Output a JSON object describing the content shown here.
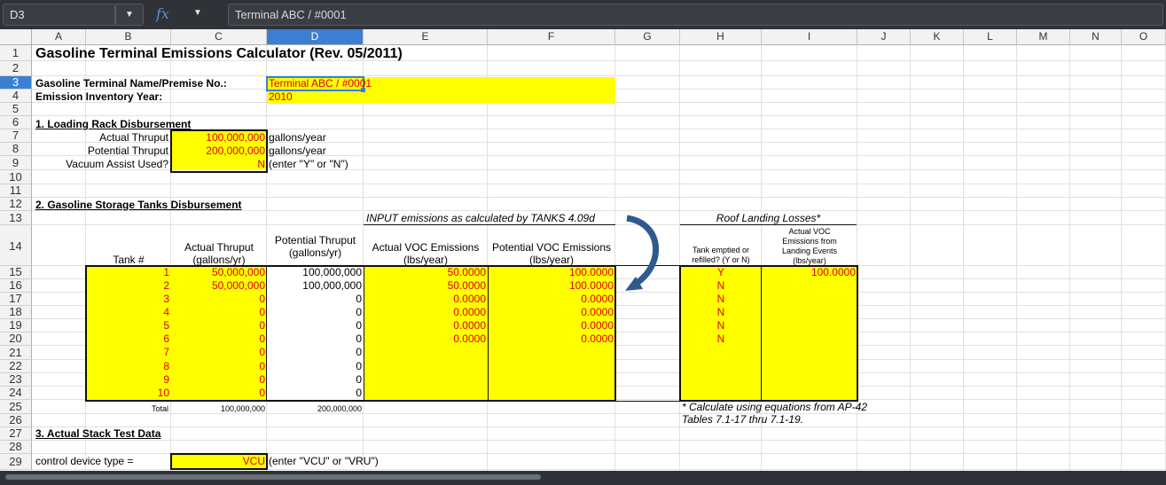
{
  "formula_bar": {
    "cell_ref": "D3",
    "fx_label": "fx",
    "formula": "Terminal ABC / #0001"
  },
  "columns": [
    "A",
    "B",
    "C",
    "D",
    "E",
    "F",
    "G",
    "H",
    "I",
    "J",
    "K",
    "L",
    "M",
    "N",
    "O"
  ],
  "rows": [
    "1",
    "2",
    "3",
    "4",
    "5",
    "6",
    "7",
    "8",
    "9",
    "10",
    "11",
    "12",
    "13",
    "14",
    "15",
    "16",
    "17",
    "18",
    "19",
    "20",
    "21",
    "22",
    "23",
    "24",
    "25",
    "26",
    "27",
    "28",
    "29"
  ],
  "sheet": {
    "title": "Gasoline Terminal Emissions Calculator (Rev. 05/2011)",
    "terminal_label": "Gasoline Terminal Name/Premise No.:",
    "terminal_value": "Terminal ABC / #0001",
    "year_label": "Emission Inventory Year:",
    "year_value": "2010",
    "sec1": "1.  Loading Rack Disbursement",
    "actual_thruput_label": "Actual Thruput",
    "actual_thruput_value": "100,000,000",
    "potential_thruput_label": "Potential Thruput",
    "potential_thruput_value": "200,000,000",
    "gal_year": "gallons/year",
    "vacuum_label": "Vacuum Assist Used?",
    "vacuum_value": "N",
    "vacuum_hint": "(enter \"Y\" or \"N\")",
    "sec2": "2. Gasoline Storage Tanks Disbursement",
    "input_note": "INPUT emissions as calculated by TANKS 4.09d",
    "roof_title": "Roof Landing Losses*",
    "h_tank": "Tank #",
    "h_actual_1": "Actual Thruput",
    "h_actual_2": "(gallons/yr)",
    "h_potential_1": "Potential Thruput",
    "h_potential_2": "(gallons/yr)",
    "h_avoc_1": "Actual VOC Emissions",
    "h_avoc_2": "(lbs/year)",
    "h_pvoc_1": "Potential VOC Emissions",
    "h_pvoc_2": "(lbs/year)",
    "h_empt_1": "Tank emptied or",
    "h_empt_2": "refilled? (Y or N)",
    "h_land_1": "Actual VOC",
    "h_land_2": "Emissions from",
    "h_land_3": "Landing Events",
    "h_land_4": "(lbs/year)",
    "tanks": [
      {
        "n": "1",
        "a": "50,000,000",
        "p": "100,000,000",
        "av": "50.0000",
        "pv": "100.0000",
        "e": "Y",
        "l": "100.0000"
      },
      {
        "n": "2",
        "a": "50,000,000",
        "p": "100,000,000",
        "av": "50.0000",
        "pv": "100.0000",
        "e": "N",
        "l": ""
      },
      {
        "n": "3",
        "a": "0",
        "p": "0",
        "av": "0.0000",
        "pv": "0.0000",
        "e": "N",
        "l": ""
      },
      {
        "n": "4",
        "a": "0",
        "p": "0",
        "av": "0.0000",
        "pv": "0.0000",
        "e": "N",
        "l": ""
      },
      {
        "n": "5",
        "a": "0",
        "p": "0",
        "av": "0.0000",
        "pv": "0.0000",
        "e": "N",
        "l": ""
      },
      {
        "n": "6",
        "a": "0",
        "p": "0",
        "av": "0.0000",
        "pv": "0.0000",
        "e": "N",
        "l": ""
      },
      {
        "n": "7",
        "a": "0",
        "p": "0",
        "av": "",
        "pv": "",
        "e": "",
        "l": ""
      },
      {
        "n": "8",
        "a": "0",
        "p": "0",
        "av": "",
        "pv": "",
        "e": "",
        "l": ""
      },
      {
        "n": "9",
        "a": "0",
        "p": "0",
        "av": "",
        "pv": "",
        "e": "",
        "l": ""
      },
      {
        "n": "10",
        "a": "0",
        "p": "0",
        "av": "",
        "pv": "",
        "e": "",
        "l": ""
      }
    ],
    "total_label": "Total",
    "total_actual": "100,000,000",
    "total_potential": "200,000,000",
    "note_1": "* Calculate using equations from AP-42",
    "note_2": "Tables 7.1-17 thru 7.1-19.",
    "sec3": "3.  Actual Stack Test Data",
    "control_label": "control device type =",
    "control_value": "VCU",
    "control_hint": "(enter \"VCU\" or \"VRU\")"
  },
  "colors": {
    "input_fill": "#ffff00",
    "input_text": "#e00000",
    "selection": "#3c7fd0",
    "arrow": "#2e5a8e"
  }
}
